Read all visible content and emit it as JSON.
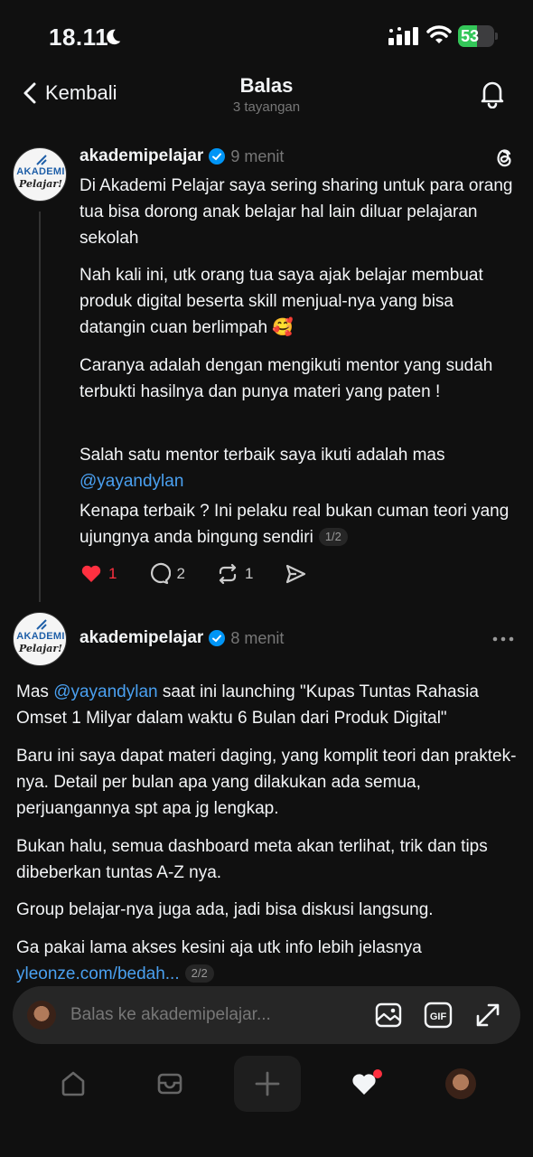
{
  "status_bar": {
    "time": "18.11",
    "battery": "53",
    "battery_level": 0.53
  },
  "header": {
    "back_label": "Kembali",
    "title": "Balas",
    "subtitle": "3 tayangan"
  },
  "posts": [
    {
      "username": "akademipelajar",
      "time": "9 menit",
      "avatar_text_top": "AKADEMI",
      "avatar_text_bottom": "Pelajar!",
      "paragraphs": [
        "Di Akademi Pelajar saya sering sharing untuk para orang tua bisa dorong anak belajar hal lain diluar pelajaran sekolah",
        "Nah kali ini, utk orang tua saya ajak belajar membuat produk digital beserta skill menjual-nya yang bisa datangin cuan berlimpah",
        "Caranya adalah dengan mengikuti mentor yang sudah terbukti hasilnya dan punya materi yang paten !",
        "Salah satu mentor terbaik saya ikuti adalah mas",
        "Kenapa terbaik ? Ini pelaku real bukan cuman teori yang ujungnya anda bingung sendiri"
      ],
      "emoji": "🥰",
      "mention": "@yayandylan",
      "page_indicator": "1/2",
      "likes": "1",
      "replies": "2",
      "reposts": "1"
    },
    {
      "username": "akademipelajar",
      "time": "8 menit",
      "avatar_text_top": "AKADEMI",
      "avatar_text_bottom": "Pelajar!",
      "p1_before": "Mas",
      "mention": "@yayandylan",
      "p1_after": "saat ini launching \"Kupas Tuntas Rahasia Omset 1 Milyar dalam waktu 6 Bulan dari Produk Digital\"",
      "paragraphs": [
        "Baru ini saya dapat materi daging, yang komplit teori dan praktek-nya. Detail per bulan apa yang dilakukan ada semua, perjuangannya spt apa jg lengkap.",
        "Bukan halu, semua dashboard meta akan terlihat, trik dan tips dibeberkan tuntas A-Z nya.",
        "Group belajar-nya juga ada, jadi bisa diskusi langsung.",
        "Ga pakai lama akses kesini aja utk info lebih jelasnya"
      ],
      "link": "yleonze.com/bedah...",
      "page_indicator": "2/2"
    }
  ],
  "reply_bar": {
    "placeholder": "Balas ke akademipelajar..."
  },
  "colors": {
    "background": "#101010",
    "link": "#4aa0f0",
    "like": "#ff3040",
    "verified": "#0095f6",
    "battery": "#34c759"
  },
  "icons": [
    "moon-icon",
    "signal-icon",
    "wifi-icon",
    "chevron-left-icon",
    "bell-icon",
    "verified-icon",
    "threads-icon",
    "heart-icon",
    "comment-icon",
    "repost-icon",
    "share-icon",
    "more-icon",
    "image-icon",
    "gif-icon",
    "expand-icon",
    "home-icon",
    "inbox-icon",
    "plus-icon",
    "activity-heart-icon"
  ]
}
